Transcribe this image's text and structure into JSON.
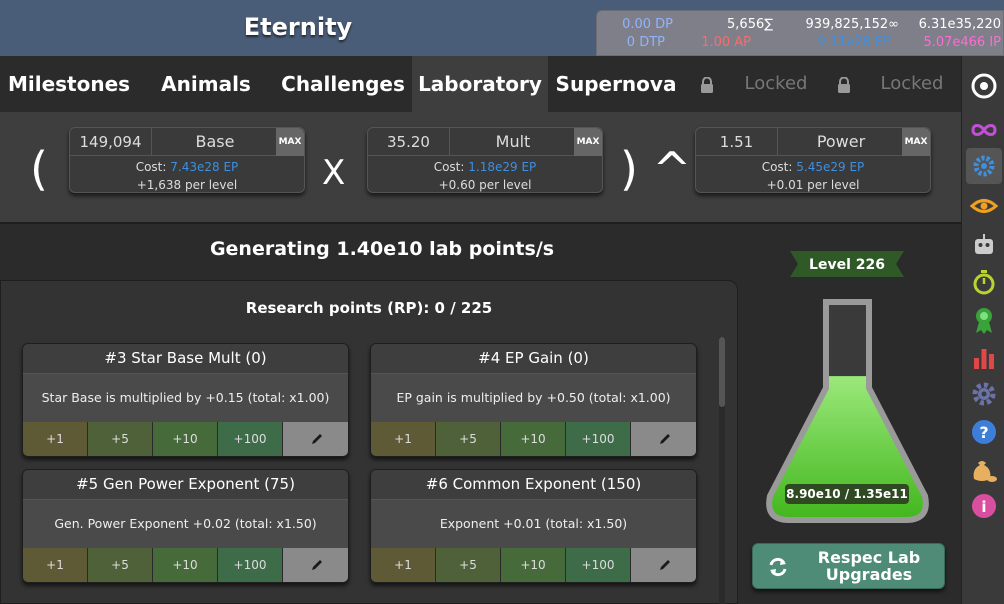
{
  "header": {
    "title": "Eternity",
    "currencies": {
      "dp": "0.00 DP",
      "dtp": "0 DTP",
      "sigma": "5,656∑",
      "ap": "1.00 AP",
      "infinity": "939,825,152∞",
      "ep": "9.11e28 EP",
      "top_right": "6.31e35,220",
      "ip": "5.07e466 IP"
    },
    "colors": {
      "dp": "#8fb4ff",
      "ap": "#ff6b6b",
      "ep": "#3d8fe0",
      "ip": "#ff6bd6"
    }
  },
  "tabs": [
    {
      "label": "Milestones"
    },
    {
      "label": "Animals"
    },
    {
      "label": "Challenges"
    },
    {
      "label": "Laboratory"
    },
    {
      "label": "Supernova"
    },
    {
      "label": "Locked"
    },
    {
      "label": "Locked"
    }
  ],
  "formula": {
    "open_paren": "(",
    "times": "X",
    "close_power": ") ^",
    "base": {
      "value": "149,094",
      "name": "Base",
      "max": "MAX",
      "cost_label": "Cost:",
      "cost": "7.43e28 EP",
      "per_level": "+1,638 per level"
    },
    "mult": {
      "value": "35.20",
      "name": "Mult",
      "max": "MAX",
      "cost_label": "Cost:",
      "cost": "1.18e29 EP",
      "per_level": "+0.60 per level"
    },
    "power": {
      "value": "1.51",
      "name": "Power",
      "max": "MAX",
      "cost_label": "Cost:",
      "cost": "5.45e29 EP",
      "per_level": "+0.01 per level"
    }
  },
  "generating": "Generating 1.40e10 lab points/s",
  "research_points": "Research points (RP): 0 / 225",
  "buy_buttons": [
    "+1",
    "+5",
    "+10",
    "+100"
  ],
  "upgrades": [
    {
      "title": "#3 Star Base Mult (0)",
      "desc": "Star Base is multiplied by +0.15 (total: x1.00)"
    },
    {
      "title": "#4 EP Gain (0)",
      "desc": "EP gain is multiplied by +0.50 (total: x1.00)"
    },
    {
      "title": "#5 Gen Power Exponent (75)",
      "desc": "Gen. Power Exponent +0.02 (total: x1.50)"
    },
    {
      "title": "#6 Common Exponent (150)",
      "desc": "Exponent +0.01 (total: x1.50)"
    }
  ],
  "flask": {
    "level": "Level 226",
    "progress_text": "8.90e10 / 1.35e11",
    "fill_fraction": 0.66,
    "fill_color": "#5fcf2f"
  },
  "respec": {
    "label_line1": "Respec Lab",
    "label_line2": "Upgrades"
  },
  "sidebar_icons": [
    "target-icon",
    "infinity-icon",
    "gear-cluster-icon",
    "eye-icon",
    "robot-icon",
    "stopwatch-icon",
    "ribbon-icon",
    "bar-chart-icon",
    "settings-icon",
    "help-icon",
    "money-bag-icon",
    "info-icon"
  ]
}
